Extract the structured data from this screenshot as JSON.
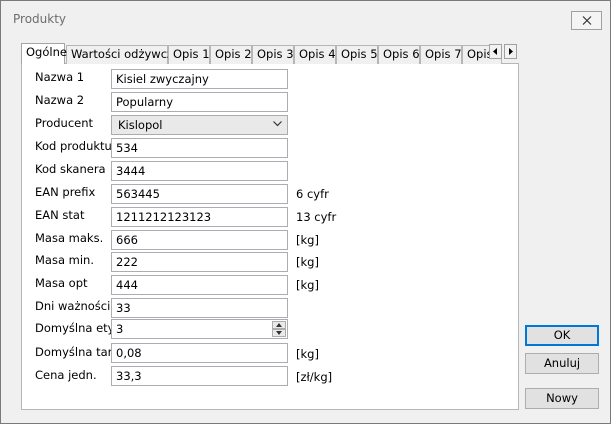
{
  "window": {
    "title": "Produkty"
  },
  "tabs": [
    {
      "label": "Ogólne",
      "active": true
    },
    {
      "label": "Wartości odżywcze"
    },
    {
      "label": "Opis 1"
    },
    {
      "label": "Opis 2"
    },
    {
      "label": "Opis 3"
    },
    {
      "label": "Opis 4"
    },
    {
      "label": "Opis 5"
    },
    {
      "label": "Opis 6"
    },
    {
      "label": "Opis 7"
    },
    {
      "label": "Opis"
    }
  ],
  "form": {
    "nazwa1": {
      "label": "Nazwa 1",
      "value": "Kisiel zwyczajny"
    },
    "nazwa2": {
      "label": "Nazwa 2",
      "value": "Popularny"
    },
    "producent": {
      "label": "Producent",
      "value": "Kislopol"
    },
    "kod_produktu": {
      "label": "Kod produktu",
      "value": "534"
    },
    "kod_skanera": {
      "label": "Kod skanera",
      "value": "3444"
    },
    "ean_prefix": {
      "label": "EAN prefix",
      "value": "563445",
      "unit": "6 cyfr"
    },
    "ean_stat": {
      "label": "EAN stat",
      "value": "1211212123123",
      "unit": "13 cyfr"
    },
    "masa_maks": {
      "label": "Masa maks.",
      "value": "666",
      "unit": "[kg]"
    },
    "masa_min": {
      "label": "Masa min.",
      "value": "222",
      "unit": "[kg]"
    },
    "masa_opt": {
      "label": "Masa opt",
      "value": "444",
      "unit": "[kg]"
    },
    "dni_waznosci": {
      "label": "Dni ważności",
      "value": "33"
    },
    "domyslna_etyk": {
      "label": "Domyślna etyk.",
      "value": "3"
    },
    "domyslna_tara": {
      "label": "Domyślna tara",
      "value": "0,08",
      "unit": "[kg]"
    },
    "cena_jedn": {
      "label": "Cena jedn.",
      "value": "33,3",
      "unit": "[zł/kg]"
    }
  },
  "buttons": {
    "ok": "OK",
    "anuluj": "Anuluj",
    "nowy": "Nowy"
  }
}
